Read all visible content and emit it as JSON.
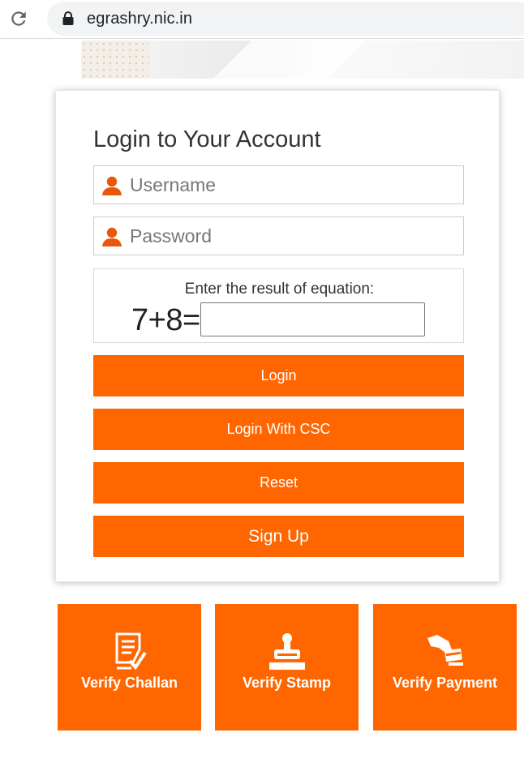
{
  "browser": {
    "url": "egrashry.nic.in"
  },
  "login": {
    "title": "Login to Your Account",
    "username_placeholder": "Username",
    "password_placeholder": "Password",
    "captcha_label": "Enter the result of equation:",
    "captcha_equation": "7+8=",
    "captcha_value": "",
    "buttons": {
      "login": "Login",
      "login_csc": "Login With CSC",
      "reset": "Reset",
      "signup": "Sign Up"
    }
  },
  "tiles": [
    {
      "label": "Verify Challan",
      "icon": "document-check-icon"
    },
    {
      "label": "Verify Stamp",
      "icon": "stamp-icon"
    },
    {
      "label": "Verify Payment",
      "icon": "card-payment-icon"
    }
  ],
  "colors": {
    "accent": "#ff6600",
    "icon_orange": "#e8580b",
    "text": "#333333",
    "tile_text": "#ffffff"
  }
}
